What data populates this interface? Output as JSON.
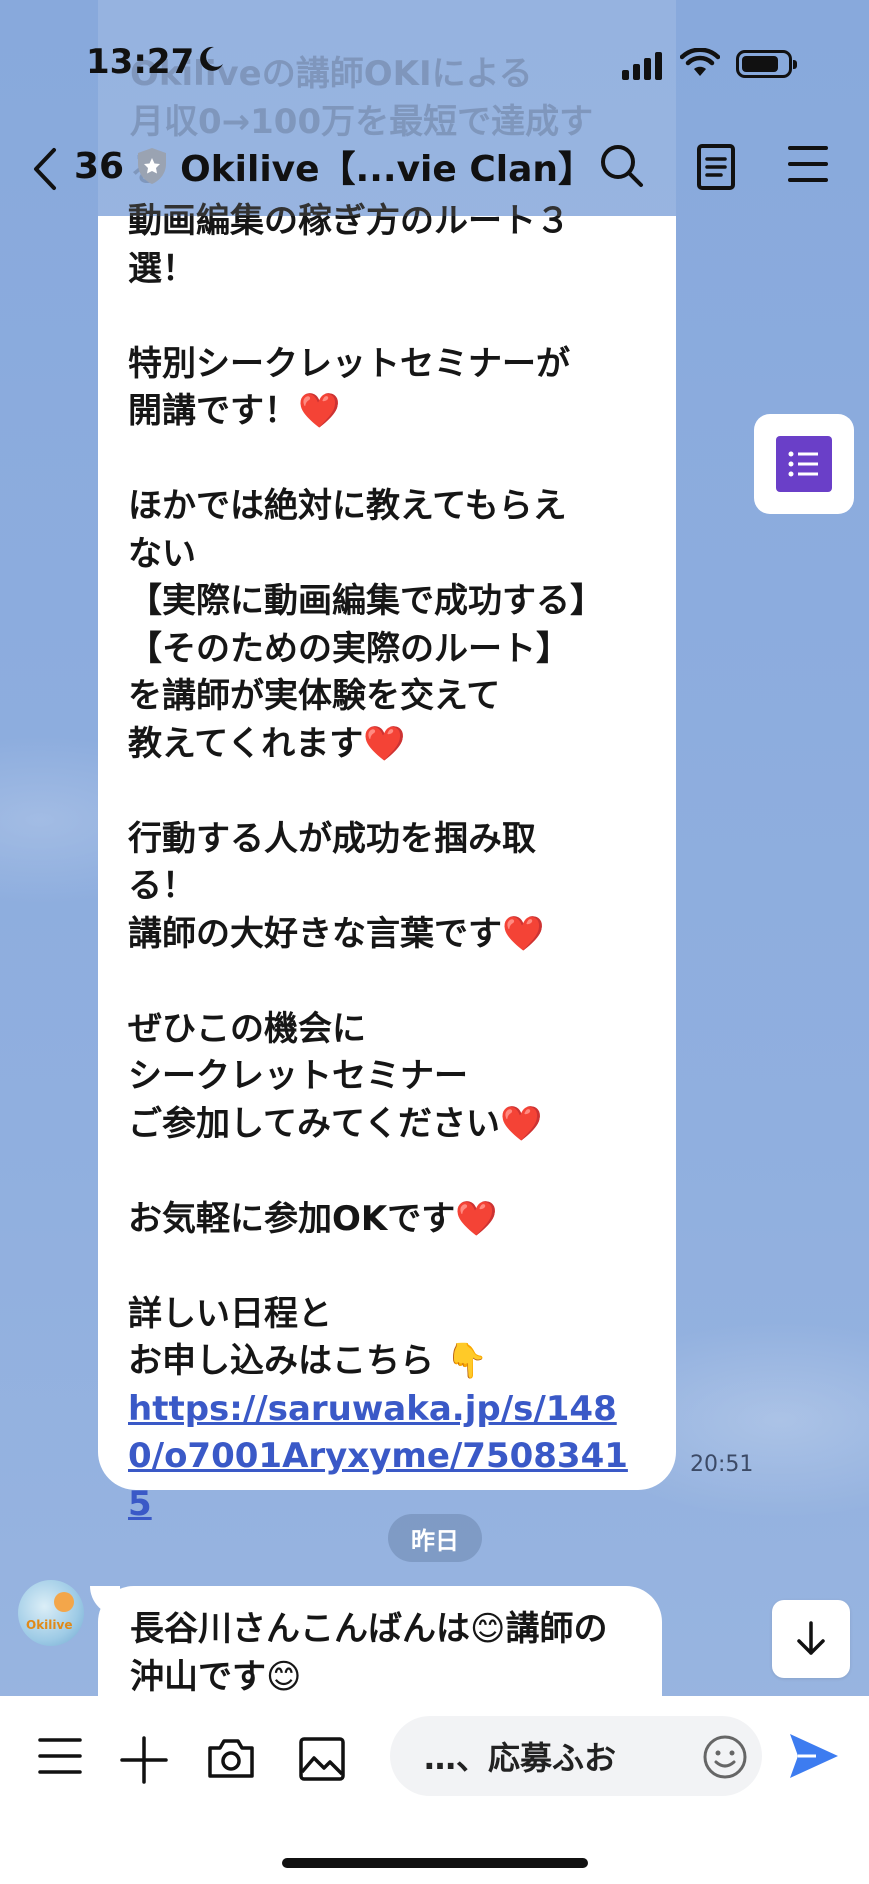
{
  "status": {
    "time": "13:27"
  },
  "ghost_lines": [
    "Okiliveの講師OKIによる",
    "月収0→100万を最短で達成す",
    "る"
  ],
  "header": {
    "count": "36",
    "title": "Okilive【...vie Clan】"
  },
  "message": {
    "text": "動画編集の稼ぎ方のルート３\n選！\n\n特別シークレットセミナーが\n開講です！❤️\n\nほかでは絶対に教えてもらえ\nない\n【実際に動画編集で成功する】\n【そのための実際のルート】\nを講師が実体験を交えて\n教えてくれます❤️\n\n行動する人が成功を掴み取\nる！\n講師の大好きな言葉です❤️\n\nぜひこの機会に\nシークレットセミナー\nご参加してみてください❤️\n\nお気軽に参加OKです❤️\n\n詳しい日程と\nお申し込みはこちら 👇\n",
    "link": "https://saruwaka.jp/s/1480/o7001Aryxyme/75083415",
    "time": "20:51"
  },
  "date_separator": "昨日",
  "avatar_logo": "Okilive",
  "message2": {
    "text": "長谷川さんこんばんは😊講師の沖山です😊"
  },
  "composer": {
    "draft": "…、応募ふお"
  }
}
